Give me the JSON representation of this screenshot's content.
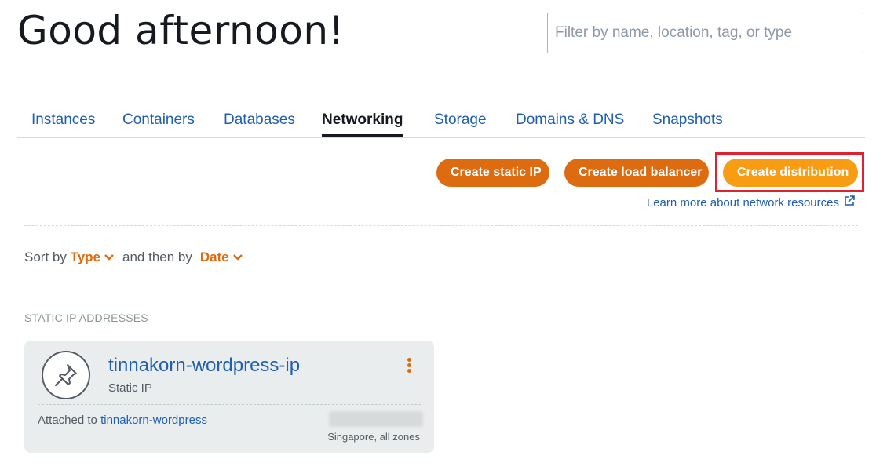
{
  "header": {
    "greeting": "Good afternoon!",
    "filter_placeholder": "Filter by name, location, tag, or type"
  },
  "tabs": [
    {
      "label": "Instances",
      "active": false
    },
    {
      "label": "Containers",
      "active": false
    },
    {
      "label": "Databases",
      "active": false
    },
    {
      "label": "Networking",
      "active": true
    },
    {
      "label": "Storage",
      "active": false
    },
    {
      "label": "Domains & DNS",
      "active": false
    },
    {
      "label": "Snapshots",
      "active": false
    }
  ],
  "actions": {
    "create_static_ip": "Create static IP",
    "create_load_balancer": "Create load balancer",
    "create_distribution": "Create distribution",
    "learn_more": "Learn more about network resources"
  },
  "sort": {
    "prefix": "Sort by",
    "primary": "Type",
    "middle": "and then by",
    "secondary": "Date"
  },
  "section_title": "STATIC IP ADDRESSES",
  "static_ip_card": {
    "icon": "pin-icon",
    "name": "tinnakorn-wordpress-ip",
    "type": "Static IP",
    "attached_prefix": "Attached to",
    "attached_instance": "tinnakorn-wordpress",
    "region": "Singapore, all zones"
  },
  "colors": {
    "accent_orange": "#dd6b10",
    "primary_orange": "#f89c14",
    "link_blue": "#1f5fae",
    "highlight_red": "#e0212f"
  }
}
